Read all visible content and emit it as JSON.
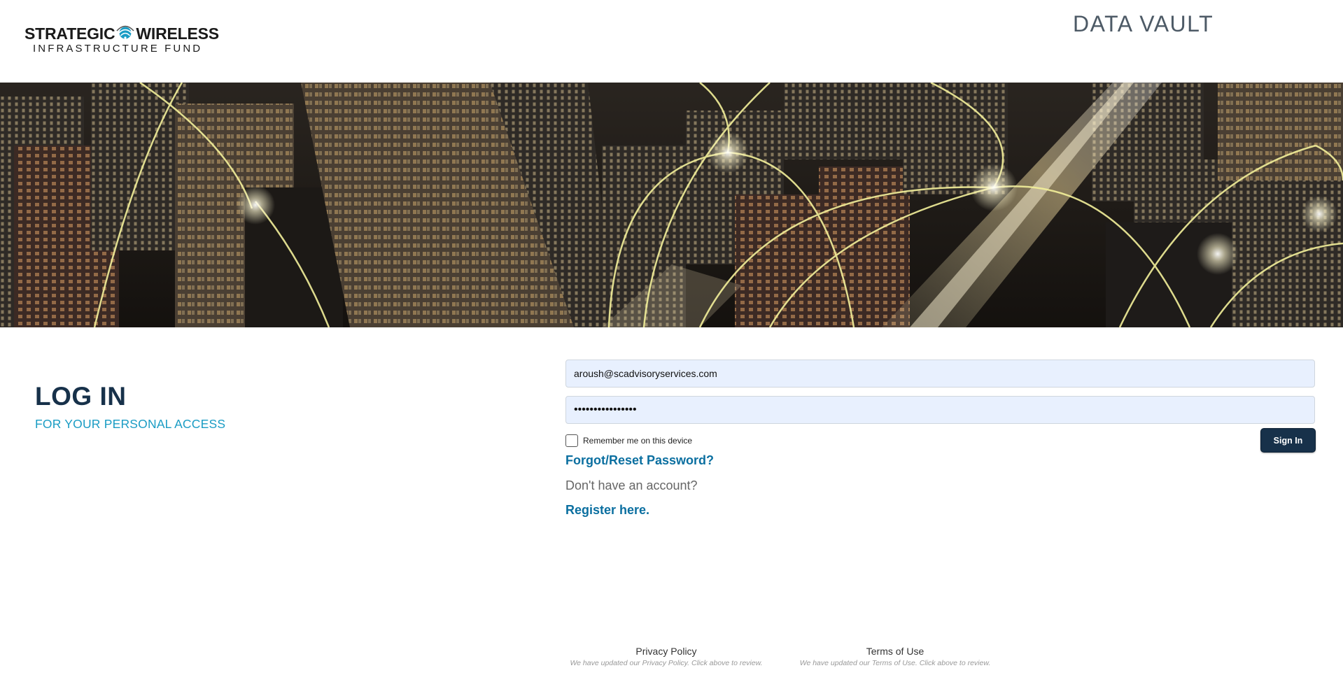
{
  "header": {
    "logo": {
      "line1_left": "STRATEGIC",
      "line1_right": "WIRELESS",
      "line2": "INFRASTRUCTURE FUND",
      "mark_icon": "globe-wave-icon"
    },
    "title": "DATA VAULT"
  },
  "banner": {
    "description_icon": "city-network-banner"
  },
  "login": {
    "heading": "LOG IN",
    "subheading": "FOR YOUR PERSONAL ACCESS"
  },
  "form": {
    "email_value": "aroush@scadvisoryservices.com",
    "password_value": "••••••••••••••••",
    "remember_label": "Remember me on this device",
    "remember_checked": false,
    "signin_label": "Sign In",
    "forgot_label": "Forgot/Reset Password?",
    "no_account_text": "Don't have an account?",
    "register_label": "Register here."
  },
  "footer": {
    "privacy_label": "Privacy Policy",
    "privacy_note": "We have updated our Privacy Policy. Click above to review.",
    "terms_label": "Terms of Use",
    "terms_note": "We have updated our Terms of Use. Click above to review."
  },
  "colors": {
    "heading": "#17314a",
    "accent": "#1a9cc4",
    "link": "#0b6fa0",
    "button": "#17314a",
    "input_bg": "#e8f0fe"
  }
}
